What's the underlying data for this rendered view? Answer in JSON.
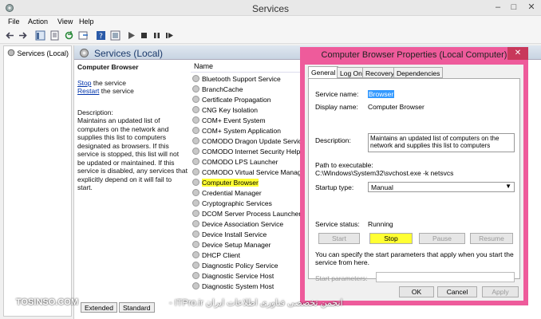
{
  "window": {
    "title": "Services"
  },
  "menu": [
    "File",
    "Action",
    "View",
    "Help"
  ],
  "tree": {
    "node": "Services (Local)"
  },
  "pane": {
    "title": "Services (Local)"
  },
  "desc": {
    "service_name": "Computer Browser",
    "stop_link": "Stop",
    "stop_rest": " the service",
    "restart_link": "Restart",
    "restart_rest": " the service",
    "label": "Description:",
    "text": "Maintains an updated list of computers on the network and supplies this list to computers designated as browsers. If this service is stopped, this list will not be updated or maintained. If this service is disabled, any services that explicitly depend on it will fail to start."
  },
  "list": {
    "column": "Name",
    "rows": [
      "Bluetooth Support Service",
      "BranchCache",
      "Certificate Propagation",
      "CNG Key Isolation",
      "COM+ Event System",
      "COM+ System Application",
      "COMODO Dragon Update Service",
      "COMODO Internet Security Helper",
      "COMODO LPS Launcher",
      "COMODO Virtual Service Manager",
      "Computer Browser",
      "Credential Manager",
      "Cryptographic Services",
      "DCOM Server Process Launcher",
      "Device Association Service",
      "Device Install Service",
      "Device Setup Manager",
      "DHCP Client",
      "Diagnostic Policy Service",
      "Diagnostic Service Host",
      "Diagnostic System Host"
    ],
    "selected": "Computer Browser"
  },
  "bottom_tabs": [
    "Extended",
    "Standard"
  ],
  "dialog": {
    "title": "Computer Browser Properties (Local Computer)",
    "close": "✕",
    "tabs": [
      "General",
      "Log On",
      "Recovery",
      "Dependencies"
    ],
    "service_name_label": "Service name:",
    "service_name": "Browser",
    "display_name_label": "Display name:",
    "display_name": "Computer Browser",
    "description_label": "Description:",
    "description": "Maintains an updated list of computers on the network and supplies this list to computers",
    "path_label": "Path to executable:",
    "path": "C:\\Windows\\System32\\svchost.exe -k netsvcs",
    "startup_label": "Startup type:",
    "startup_value": "Manual",
    "status_label": "Service status:",
    "status_value": "Running",
    "buttons": {
      "start": "Start",
      "stop": "Stop",
      "pause": "Pause",
      "resume": "Resume"
    },
    "params_help": "You can specify the start parameters that apply when you start the service from here.",
    "params_label": "Start parameters:",
    "ok": "OK",
    "cancel": "Cancel",
    "apply": "Apply"
  },
  "watermark": {
    "left": "TOSINSO.COM",
    "right": "- ITPro.ir انجمن تخصصی فناوری اطلاعات ایران"
  }
}
